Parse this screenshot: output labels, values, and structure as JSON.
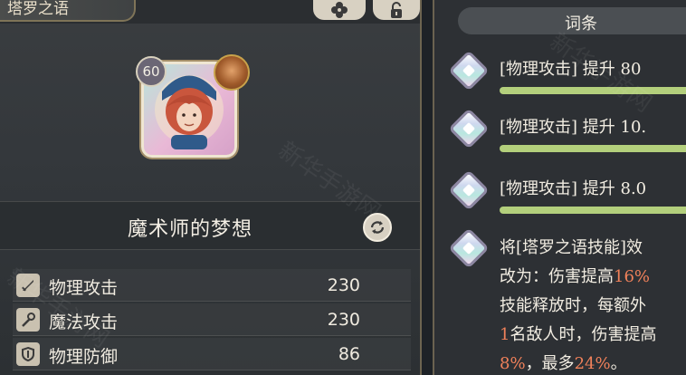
{
  "left_panel": {
    "title": "塔罗之语",
    "card": {
      "level": "60",
      "name": "魔术师的梦想"
    },
    "stats": [
      {
        "icon": "sword-icon",
        "label": "物理攻击",
        "value": "230"
      },
      {
        "icon": "wand-icon",
        "label": "魔法攻击",
        "value": "230"
      },
      {
        "icon": "shield-icon",
        "label": "物理防御",
        "value": "86"
      }
    ]
  },
  "right_panel": {
    "header": "词条",
    "entries": [
      {
        "text": "[物理攻击] 提升 80"
      },
      {
        "text": "[物理攻击] 提升 10."
      },
      {
        "text": "[物理攻击] 提升 8.0"
      }
    ],
    "skill": {
      "line1": "将[塔罗之语技能]效",
      "line2_prefix": "改为：伤害提高",
      "line2_highlight": "16%",
      "line3": "技能释放时，每额外",
      "line4_highlight": "1",
      "line4_suffix": "名敌人时，伤害提高",
      "line5_highlight_a": "8%",
      "line5_mid": "，最多",
      "line5_highlight_b": "24%",
      "line5_end": "。"
    }
  },
  "watermark_text": "新华手游网",
  "colors": {
    "accent_green": "#b3cf7c",
    "highlight": "#f0815a",
    "gold_border": "#7f7458"
  }
}
